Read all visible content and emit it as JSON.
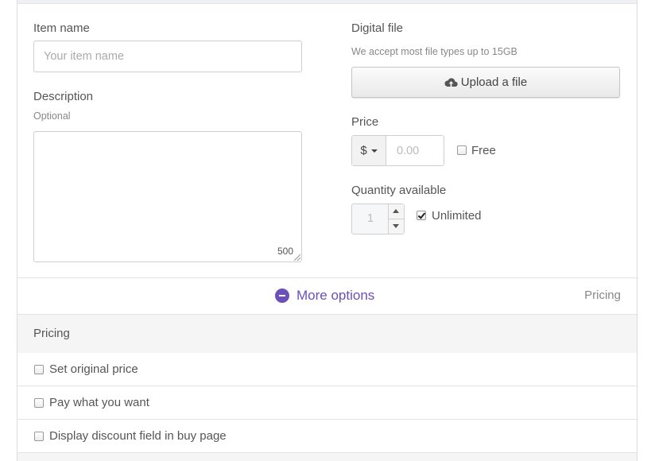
{
  "form": {
    "item_name_label": "Item name",
    "item_name_placeholder": "Your item name",
    "description_label": "Description",
    "description_help": "Optional",
    "description_counter": "500",
    "digital_file_label": "Digital file",
    "digital_file_help": "We accept most file types up to 15GB",
    "upload_label": "Upload a file",
    "upload_icon": "cloud-upload-icon",
    "price_label": "Price",
    "currency": "$",
    "price_placeholder": "0.00",
    "free_label": "Free",
    "free_checked": false,
    "quantity_label": "Quantity available",
    "quantity_value": "1",
    "unlimited_label": "Unlimited",
    "unlimited_checked": true
  },
  "more_options": {
    "label": "More options",
    "right_label": "Pricing",
    "accent_color": "#6b4fbb"
  },
  "pricing": {
    "title": "Pricing",
    "rows": [
      {
        "label": "Set original price",
        "checked": false
      },
      {
        "label": "Pay what you want",
        "checked": false
      },
      {
        "label": "Display discount field in buy page",
        "checked": false
      }
    ]
  }
}
